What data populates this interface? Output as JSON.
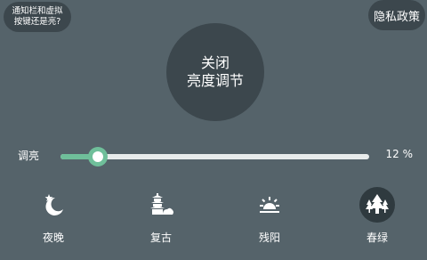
{
  "top_left": {
    "text": "通知栏和虚拟\n按键还是亮?"
  },
  "top_right": {
    "label": "隐私政策"
  },
  "main_toggle": {
    "line1": "关闭",
    "line2": "亮度调节"
  },
  "brightness": {
    "label": "调亮",
    "value_text": "12 %",
    "percent": 12
  },
  "presets": [
    {
      "label": "夜晚",
      "icon": "moon-star-icon",
      "selected": false
    },
    {
      "label": "复古",
      "icon": "pagoda-icon",
      "selected": false
    },
    {
      "label": "残阳",
      "icon": "sunset-icon",
      "selected": false
    },
    {
      "label": "春绿",
      "icon": "trees-icon",
      "selected": true
    }
  ],
  "colors": {
    "background": "#55636a",
    "panel": "#3c474d",
    "accent": "#6fbf9a"
  }
}
